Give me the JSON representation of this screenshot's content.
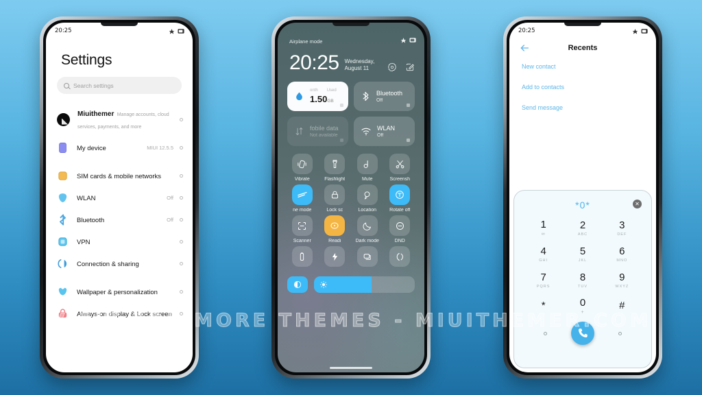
{
  "watermark": "VISIT  FOR  MORE  THEMES  -  MIUITHEMER.COM",
  "status_bar": {
    "time": "20:25"
  },
  "settings_phone": {
    "title": "Settings",
    "search": {
      "placeholder": "Search settings"
    },
    "account": {
      "name": "Miuithemer",
      "subtitle": "Manage accounts, cloud services, payments, and more"
    },
    "groups": [
      {
        "rows": [
          {
            "label": "My device",
            "value": "MIUI 12.5.5",
            "color": "#8b8ef0"
          }
        ]
      },
      {
        "rows": [
          {
            "label": "SIM cards & mobile networks",
            "value": "",
            "color": "#f3bb52"
          },
          {
            "label": "WLAN",
            "value": "Off",
            "color": "#63c3ef"
          },
          {
            "label": "Bluetooth",
            "value": "Off",
            "color": "#4ba7e0"
          },
          {
            "label": "VPN",
            "value": "",
            "color": "#5ec7ee"
          },
          {
            "label": "Connection & sharing",
            "value": "",
            "color": "#3f9ddb"
          }
        ]
      },
      {
        "rows": [
          {
            "label": "Wallpaper & personalization",
            "value": "",
            "color": "#59c4ee"
          },
          {
            "label": "Always-on display & Lock screen",
            "value": "",
            "color": "#ef8087"
          }
        ]
      }
    ]
  },
  "control_center": {
    "airplane_label": "Airplane mode",
    "clock": "20:25",
    "date": "Wednesday, August 11",
    "big_tiles": [
      {
        "name": "data-usage",
        "top_left": "onth",
        "top_right": "Used",
        "amount": "1.50",
        "unit": "GB",
        "style": "light"
      },
      {
        "name": "Bluetooth",
        "state": "Off",
        "style": "normal"
      },
      {
        "name": "fobile data",
        "state": "Not available",
        "style": "dim"
      },
      {
        "name": "WLAN",
        "state": "Off",
        "style": "normal"
      }
    ],
    "toggles": [
      {
        "label": "Vibrate",
        "icon": "vibrate-icon",
        "state": "off"
      },
      {
        "label": "Flashlight",
        "icon": "flashlight-icon",
        "state": "off"
      },
      {
        "label": "Mute",
        "icon": "mute-icon",
        "state": "off"
      },
      {
        "label": "Screensh",
        "icon": "screenshot-icon",
        "state": "off"
      },
      {
        "label": "ne mode",
        "icon": "airplane-icon",
        "state": "on"
      },
      {
        "label": "Lock sc",
        "icon": "lock-icon",
        "state": "off"
      },
      {
        "label": "Location",
        "icon": "location-icon",
        "state": "off"
      },
      {
        "label": "Rotate off",
        "icon": "rotate-icon",
        "state": "on"
      },
      {
        "label": "Scanner",
        "icon": "scanner-icon",
        "state": "off"
      },
      {
        "label": "Readi",
        "icon": "reading-icon",
        "state": "warm"
      },
      {
        "label": "Dark mode",
        "icon": "moon-icon",
        "state": "off"
      },
      {
        "label": "DND",
        "icon": "dnd-icon",
        "state": "off"
      },
      {
        "label": "",
        "icon": "battery-icon",
        "state": "off"
      },
      {
        "label": "",
        "icon": "power-icon",
        "state": "off"
      },
      {
        "label": "",
        "icon": "cast-icon",
        "state": "off"
      },
      {
        "label": "",
        "icon": "sound-icon",
        "state": "off"
      }
    ],
    "brightness": {
      "percent": 57
    }
  },
  "dialer_phone": {
    "header_title": "Recents",
    "links": [
      "New contact",
      "Add to contacts",
      "Send message"
    ],
    "dialed_number": "*0*",
    "keys": [
      {
        "digit": "1",
        "sub": "∞"
      },
      {
        "digit": "2",
        "sub": "ABC"
      },
      {
        "digit": "3",
        "sub": "DEF"
      },
      {
        "digit": "4",
        "sub": "GHI"
      },
      {
        "digit": "5",
        "sub": "JKL"
      },
      {
        "digit": "6",
        "sub": "MNO"
      },
      {
        "digit": "7",
        "sub": "PQRS"
      },
      {
        "digit": "8",
        "sub": "TUV"
      },
      {
        "digit": "9",
        "sub": "WXYZ"
      },
      {
        "digit": "*",
        "sub": ""
      },
      {
        "digit": "0",
        "sub": "+"
      },
      {
        "digit": "#",
        "sub": ""
      }
    ]
  },
  "colors": {
    "accent_blue": "#3dbbf8",
    "link_blue": "#5fb6e8",
    "warm": "#f5b543"
  }
}
